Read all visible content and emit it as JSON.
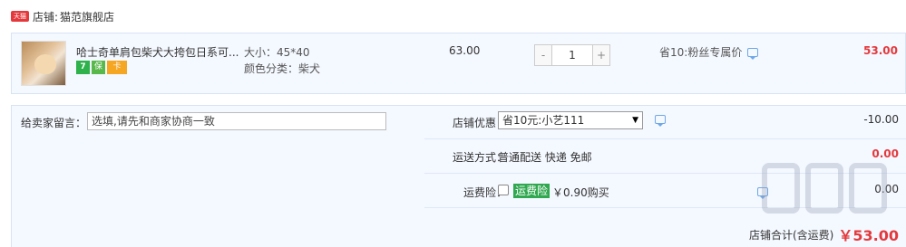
{
  "shop": {
    "badge_text": "天猫",
    "label": "店铺:",
    "name": "猫范旗舰店"
  },
  "item": {
    "title": "哈士奇单肩包柴犬大挎包日系可...",
    "badges": [
      "7",
      "保",
      "卡"
    ],
    "sku_size": "大小：45*40",
    "sku_color": "颜色分类：柴犬",
    "unit_price": "63.00",
    "qty_minus": "-",
    "qty_value": "1",
    "qty_plus": "+",
    "promo": "省10:粉丝专属价",
    "total": "53.00"
  },
  "extras": {
    "message_label": "给卖家留言：",
    "message_placeholder": "选填,请先和商家协商一致",
    "coupon_label": "店铺优惠：",
    "coupon_selected": "省10元:小艺111",
    "coupon_amount": "-10.00",
    "shipping_label": "运送方式：",
    "shipping_text": "普通配送 快递 免邮",
    "shipping_amount": "0.00",
    "insurance_label": "运费险：",
    "insurance_tag": "运费险",
    "insurance_price": "￥0.90购买",
    "insurance_amount": "0.00",
    "shop_total_label": "店铺合计(含运费)",
    "shop_total": "￥53.00"
  },
  "colors": {
    "accent_red": "#e4393c",
    "panel_bg": "#f4f8ff",
    "insurance_green": "#2fa84f"
  }
}
